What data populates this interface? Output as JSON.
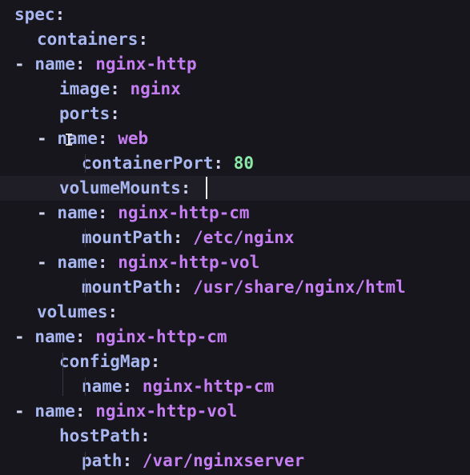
{
  "lines": [
    {
      "indent": 0,
      "dash": "",
      "key": "spec",
      "colon": ":",
      "value": "",
      "type": ""
    },
    {
      "indent": 1,
      "dash": "",
      "key": "containers",
      "colon": ":",
      "value": "",
      "type": ""
    },
    {
      "indent": 1,
      "dash": "-",
      "key": "name",
      "colon": ":",
      "value": "nginx-http",
      "type": "str"
    },
    {
      "indent": 2,
      "dash": "",
      "key": "image",
      "colon": ":",
      "value": "nginx",
      "type": "str"
    },
    {
      "indent": 2,
      "dash": "",
      "key": "ports",
      "colon": ":",
      "value": "",
      "type": ""
    },
    {
      "indent": 2,
      "dash": "-",
      "key": "name",
      "colon": ":",
      "value": "web",
      "type": "str"
    },
    {
      "indent": 3,
      "dash": "",
      "key": "containerPort",
      "colon": ":",
      "value": "80",
      "type": "num"
    },
    {
      "indent": 2,
      "dash": "",
      "key": "volumeMounts",
      "colon": ":",
      "value": "",
      "type": "",
      "current": true
    },
    {
      "indent": 2,
      "dash": "-",
      "key": "name",
      "colon": ":",
      "value": "nginx-http-cm",
      "type": "str"
    },
    {
      "indent": 3,
      "dash": "",
      "key": "mountPath",
      "colon": ":",
      "value": "/etc/nginx",
      "type": "str"
    },
    {
      "indent": 2,
      "dash": "-",
      "key": "name",
      "colon": ":",
      "value": "nginx-http-vol",
      "type": "str"
    },
    {
      "indent": 3,
      "dash": "",
      "key": "mountPath",
      "colon": ":",
      "value": "/usr/share/nginx/html",
      "type": "str"
    },
    {
      "indent": 1,
      "dash": "",
      "key": "volumes",
      "colon": ":",
      "value": "",
      "type": ""
    },
    {
      "indent": 1,
      "dash": "-",
      "key": "name",
      "colon": ":",
      "value": "nginx-http-cm",
      "type": "str"
    },
    {
      "indent": 2,
      "dash": "",
      "key": "configMap",
      "colon": ":",
      "value": "",
      "type": ""
    },
    {
      "indent": 3,
      "dash": "",
      "key": "name",
      "colon": ":",
      "value": "nginx-http-cm",
      "type": "str"
    },
    {
      "indent": 1,
      "dash": "-",
      "key": "name",
      "colon": ":",
      "value": "nginx-http-vol",
      "type": "str"
    },
    {
      "indent": 2,
      "dash": "",
      "key": "hostPath",
      "colon": ":",
      "value": "",
      "type": ""
    },
    {
      "indent": 3,
      "dash": "",
      "key": "path",
      "colon": ":",
      "value": "/var/nginxserver",
      "type": "str"
    }
  ],
  "colors": {
    "background": "#18161d",
    "key": "#a9b7f0",
    "string_value": "#c57ef2",
    "number_value": "#8be9a8",
    "punctuation": "#cfd3ee",
    "indent_guide": "#3a3744",
    "current_line": "#1f1d25"
  }
}
